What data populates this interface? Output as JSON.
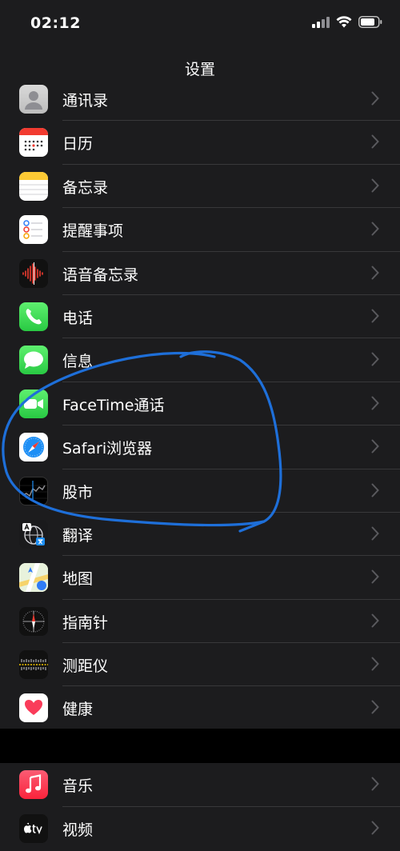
{
  "status": {
    "time": "02:12"
  },
  "nav": {
    "title": "设置"
  },
  "group1": [
    {
      "label": "通讯录",
      "icon": "contacts-icon"
    },
    {
      "label": "日历",
      "icon": "calendar-icon"
    },
    {
      "label": "备忘录",
      "icon": "notes-icon"
    },
    {
      "label": "提醒事项",
      "icon": "reminders-icon"
    },
    {
      "label": "语音备忘录",
      "icon": "voice-memos-icon"
    },
    {
      "label": "电话",
      "icon": "phone-icon"
    },
    {
      "label": "信息",
      "icon": "messages-icon"
    },
    {
      "label": "FaceTime通话",
      "icon": "facetime-icon"
    },
    {
      "label": "Safari浏览器",
      "icon": "safari-icon"
    },
    {
      "label": "股市",
      "icon": "stocks-icon"
    },
    {
      "label": "翻译",
      "icon": "translate-icon"
    },
    {
      "label": "地图",
      "icon": "maps-icon"
    },
    {
      "label": "指南针",
      "icon": "compass-icon"
    },
    {
      "label": "测距仪",
      "icon": "measure-icon"
    },
    {
      "label": "健康",
      "icon": "health-icon"
    }
  ],
  "group2": [
    {
      "label": "音乐",
      "icon": "music-icon"
    },
    {
      "label": "视频",
      "icon": "apple-tv-icon"
    }
  ],
  "colors": {
    "background": "#000000",
    "cell": "#1c1c1e",
    "separator": "#38383a",
    "chevron": "#5a5a5e",
    "annotation": "#1e6fd9"
  }
}
